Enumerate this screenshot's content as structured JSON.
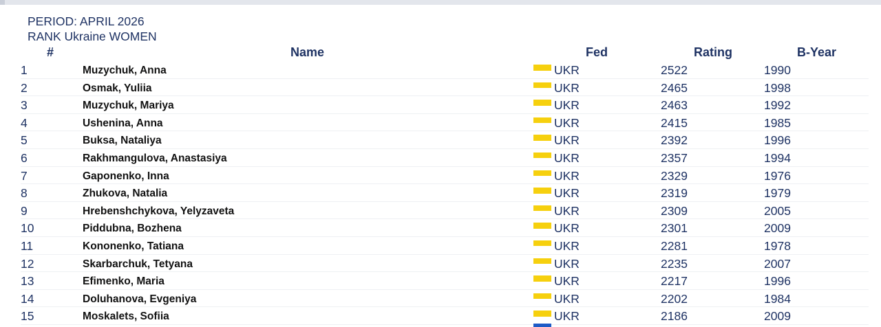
{
  "header": {
    "period": "PERIOD: APRIL 2026",
    "rank_title": "RANK Ukraine WOMEN"
  },
  "columns": {
    "rank": "#",
    "name": "Name",
    "fed": "Fed",
    "rating": "Rating",
    "byear": "B-Year"
  },
  "colors": {
    "header_text": "#1e3263",
    "flag_blue": "#1e5bc6",
    "flag_yellow": "#f6d00e"
  },
  "rows": [
    {
      "rank": "1",
      "name": "Muzychuk, Anna",
      "fed": "UKR",
      "rating": "2522",
      "byear": "1990"
    },
    {
      "rank": "2",
      "name": "Osmak, Yuliia",
      "fed": "UKR",
      "rating": "2465",
      "byear": "1998"
    },
    {
      "rank": "3",
      "name": "Muzychuk, Mariya",
      "fed": "UKR",
      "rating": "2463",
      "byear": "1992"
    },
    {
      "rank": "4",
      "name": "Ushenina, Anna",
      "fed": "UKR",
      "rating": "2415",
      "byear": "1985"
    },
    {
      "rank": "5",
      "name": "Buksa, Nataliya",
      "fed": "UKR",
      "rating": "2392",
      "byear": "1996"
    },
    {
      "rank": "6",
      "name": "Rakhmangulova, Anastasiya",
      "fed": "UKR",
      "rating": "2357",
      "byear": "1994"
    },
    {
      "rank": "7",
      "name": "Gaponenko, Inna",
      "fed": "UKR",
      "rating": "2329",
      "byear": "1976"
    },
    {
      "rank": "8",
      "name": "Zhukova, Natalia",
      "fed": "UKR",
      "rating": "2319",
      "byear": "1979"
    },
    {
      "rank": "9",
      "name": "Hrebenshchykova, Yelyzaveta",
      "fed": "UKR",
      "rating": "2309",
      "byear": "2005"
    },
    {
      "rank": "10",
      "name": "Piddubna, Bozhena",
      "fed": "UKR",
      "rating": "2301",
      "byear": "2009"
    },
    {
      "rank": "11",
      "name": "Kononenko, Tatiana",
      "fed": "UKR",
      "rating": "2281",
      "byear": "1978"
    },
    {
      "rank": "12",
      "name": "Skarbarchuk, Tetyana",
      "fed": "UKR",
      "rating": "2235",
      "byear": "2007"
    },
    {
      "rank": "13",
      "name": "Efimenko, Maria",
      "fed": "UKR",
      "rating": "2217",
      "byear": "1996"
    },
    {
      "rank": "14",
      "name": "Doluhanova, Evgeniya",
      "fed": "UKR",
      "rating": "2202",
      "byear": "1984"
    },
    {
      "rank": "15",
      "name": "Moskalets, Sofiia",
      "fed": "UKR",
      "rating": "2186",
      "byear": "2009"
    }
  ]
}
